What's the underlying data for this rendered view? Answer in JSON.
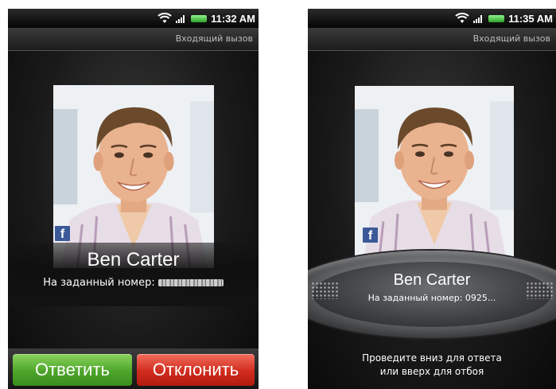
{
  "screen_answer_buttons": {
    "status_time": "11:32 AM",
    "call_state": "Входящий вызов",
    "contact_name": "Ben Carter",
    "subtitle_label": "На заданный номер:",
    "answer_label": "Ответить",
    "decline_label": "Отклонить"
  },
  "screen_slide_ring": {
    "status_time": "11:35 AM",
    "call_state": "Входящий вызов",
    "contact_name": "Ben Carter",
    "subtitle_text": "На заданный номер: 0925...",
    "hint_line1": "Проведите вниз для ответа",
    "hint_line2": "или вверх для отбоя"
  },
  "icons": {
    "facebook": "f"
  },
  "colors": {
    "answer_green": "#4da52a",
    "decline_red": "#d02b1c",
    "battery_green": "#2ea32a",
    "facebook_blue": "#3b5998"
  }
}
